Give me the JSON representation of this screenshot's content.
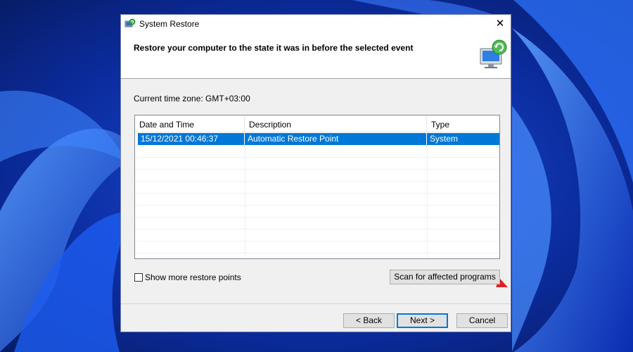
{
  "window": {
    "title": "System Restore",
    "close_glyph": "✕",
    "app_icon": "system-restore-icon"
  },
  "header": {
    "heading": "Restore your computer to the state it was in before the selected event",
    "icon": "system-restore-monitor-icon"
  },
  "timezone_text": "Current time zone: GMT+03:00",
  "table": {
    "columns": [
      "Date and Time",
      "Description",
      "Type"
    ],
    "sort_indicator": "⌄",
    "rows": [
      {
        "date": "15/12/2021 00:46:37",
        "description": "Automatic Restore Point",
        "type": "System",
        "selected": true
      }
    ]
  },
  "checkbox": {
    "label": "Show more restore points",
    "checked": false
  },
  "buttons": {
    "scan": "Scan for affected programs",
    "back": "< Back",
    "next": "Next >",
    "cancel": "Cancel"
  },
  "colors": {
    "selection": "#0078d7",
    "annotation_arrow": "#e02020",
    "wallpaper": "#0a1f7a"
  }
}
